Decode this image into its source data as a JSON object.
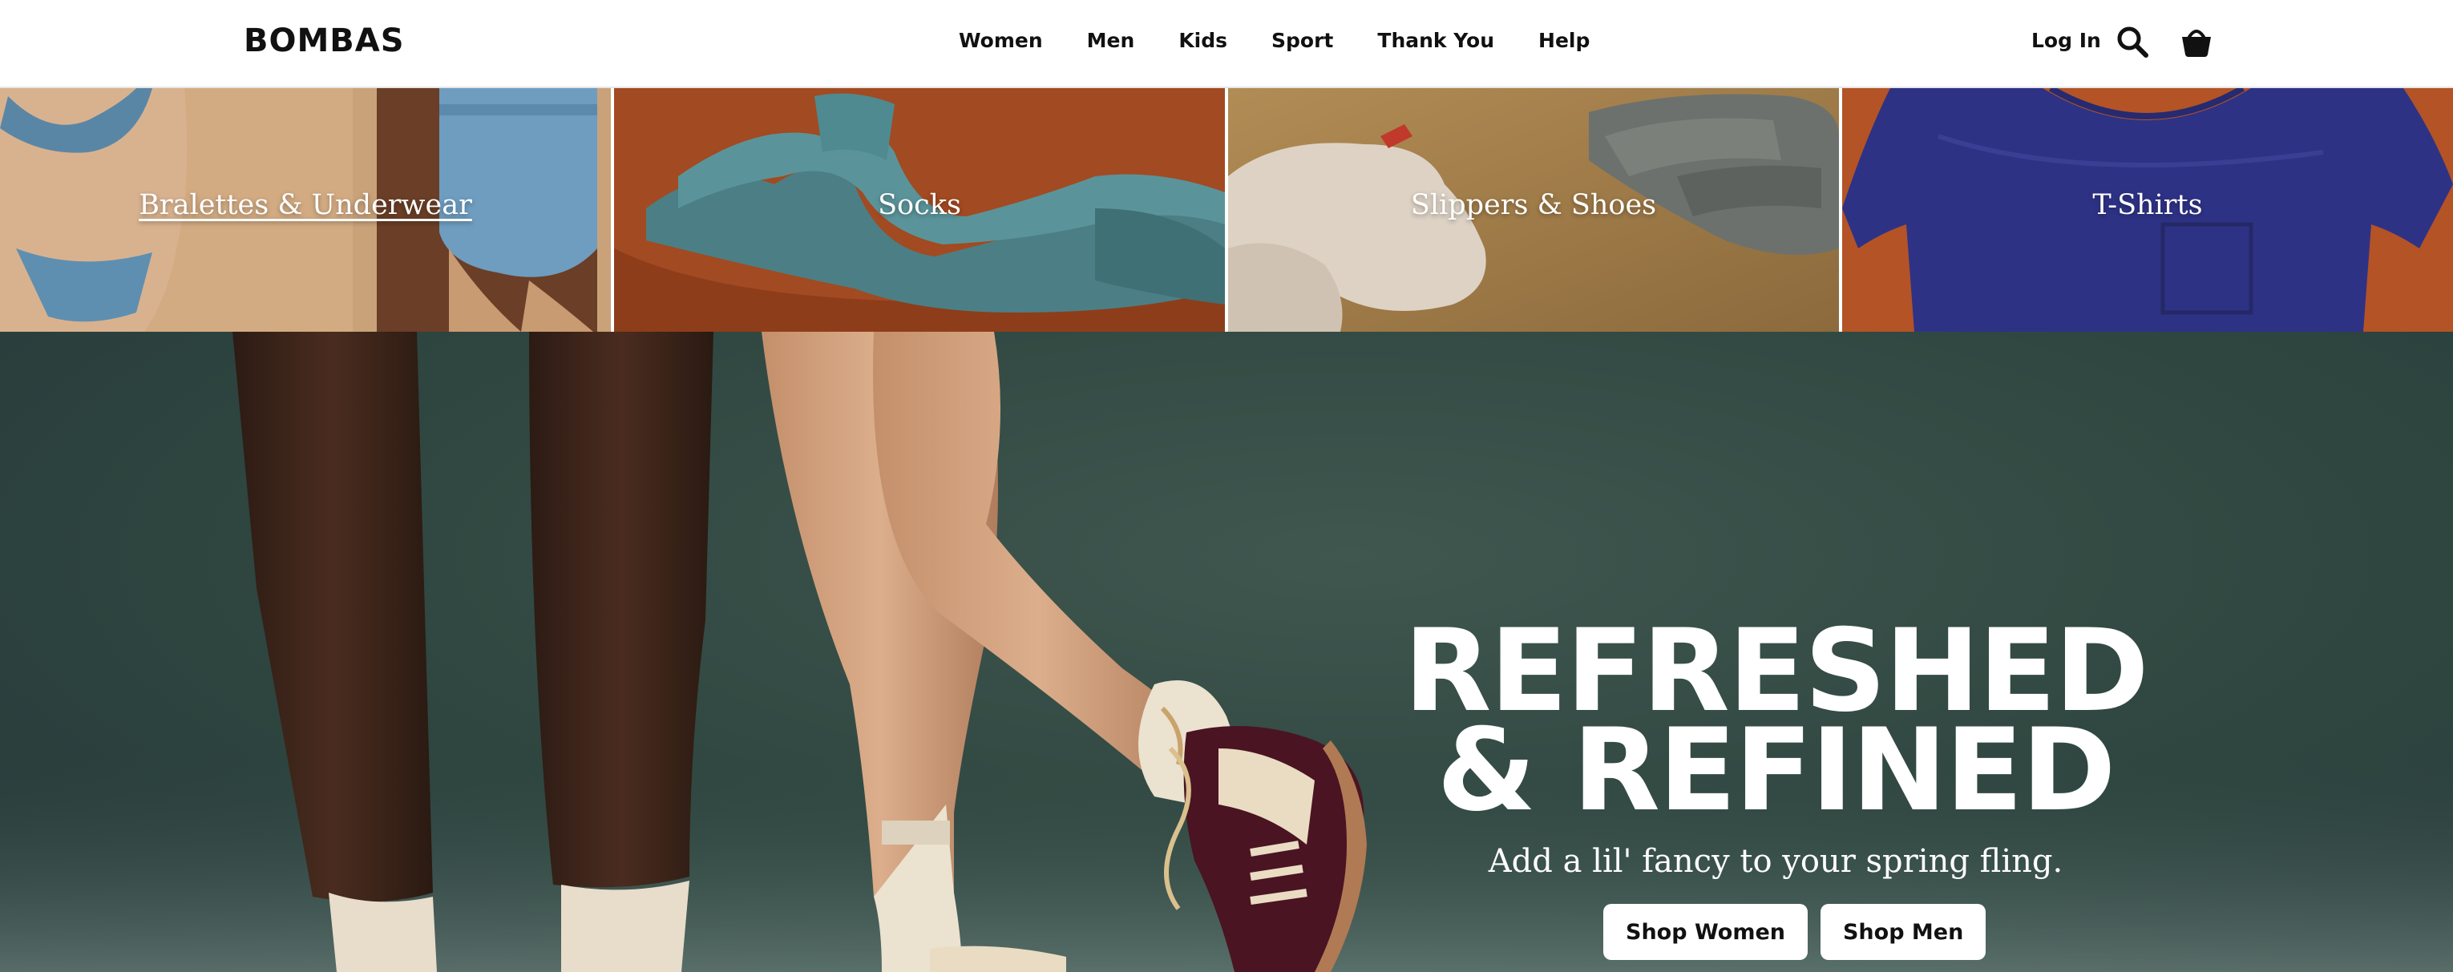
{
  "header": {
    "logo": "BOMBAS",
    "nav": [
      "Women",
      "Men",
      "Kids",
      "Sport",
      "Thank You",
      "Help"
    ],
    "login_label": "Log In",
    "icons": [
      "search-icon",
      "cart-icon"
    ]
  },
  "categories": [
    {
      "label": "Bralettes & Underwear",
      "bg": "#c9a27a"
    },
    {
      "label": "Socks",
      "bg": "#a24a22"
    },
    {
      "label": "Slippers & Shoes",
      "bg": "#a07c4a"
    },
    {
      "label": "T-Shirts",
      "bg": "#b35326"
    }
  ],
  "hero": {
    "title_line1": "REFRESHED",
    "title_line2": "& REFINED",
    "subtitle": "Add a lil' fancy to your spring fling.",
    "buttons": [
      "Shop Women",
      "Shop Men"
    ],
    "bg": "#2f4640"
  }
}
